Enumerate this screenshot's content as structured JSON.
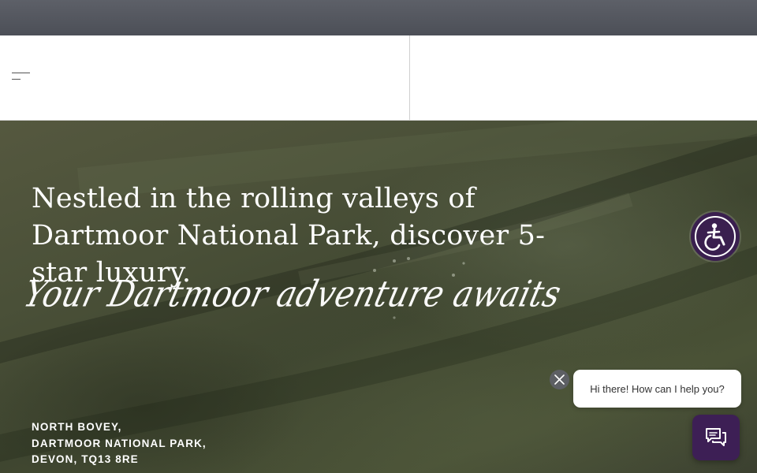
{
  "hero": {
    "heading": "Nestled in the rolling valleys of Dartmoor National Park, discover 5-star luxury.",
    "script_tagline": "Your Dartmoor adventure awaits",
    "address": [
      "NORTH BOVEY,",
      "DARTMOOR NATIONAL PARK,",
      "DEVON, TQ13 8RE"
    ]
  },
  "chat": {
    "greeting": "Hi there! How can I help you?"
  },
  "icons": {
    "menu": "hamburger-menu-icon",
    "accessibility": "accessibility-icon",
    "close": "close-icon",
    "chat": "chat-bubbles-icon"
  },
  "colors": {
    "topbar": "#555860",
    "header_bg": "#ffffff",
    "hero_text": "#ffffff",
    "brand_purple": "#3d1f55",
    "close_button": "#5d5f64"
  }
}
